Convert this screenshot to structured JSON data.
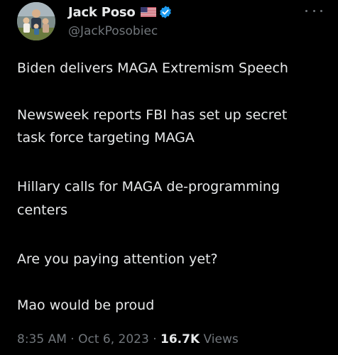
{
  "author": {
    "display_name": "Jack Poso",
    "handle": "@JackPosobiec",
    "flag_icon": "us-flag-icon",
    "verified_icon": "verified-badge-icon",
    "verified_color": "#1d9bf0"
  },
  "more_icon": "more-horizontal-icon",
  "tweet": {
    "lines": [
      "Biden delivers MAGA Extremism Speech",
      "Newsweek reports FBI has set up secret",
      "task force targeting MAGA",
      "Hillary calls for MAGA de-programming",
      "centers",
      "Are you paying attention yet?",
      "Mao would be proud"
    ]
  },
  "meta": {
    "time": "8:35 AM",
    "separator": "·",
    "date": "Oct 6, 2023",
    "views_count": "16.7K",
    "views_label": "Views"
  },
  "colors": {
    "background": "#000000",
    "text": "#e7e9ea",
    "secondary_text": "#71767b"
  }
}
